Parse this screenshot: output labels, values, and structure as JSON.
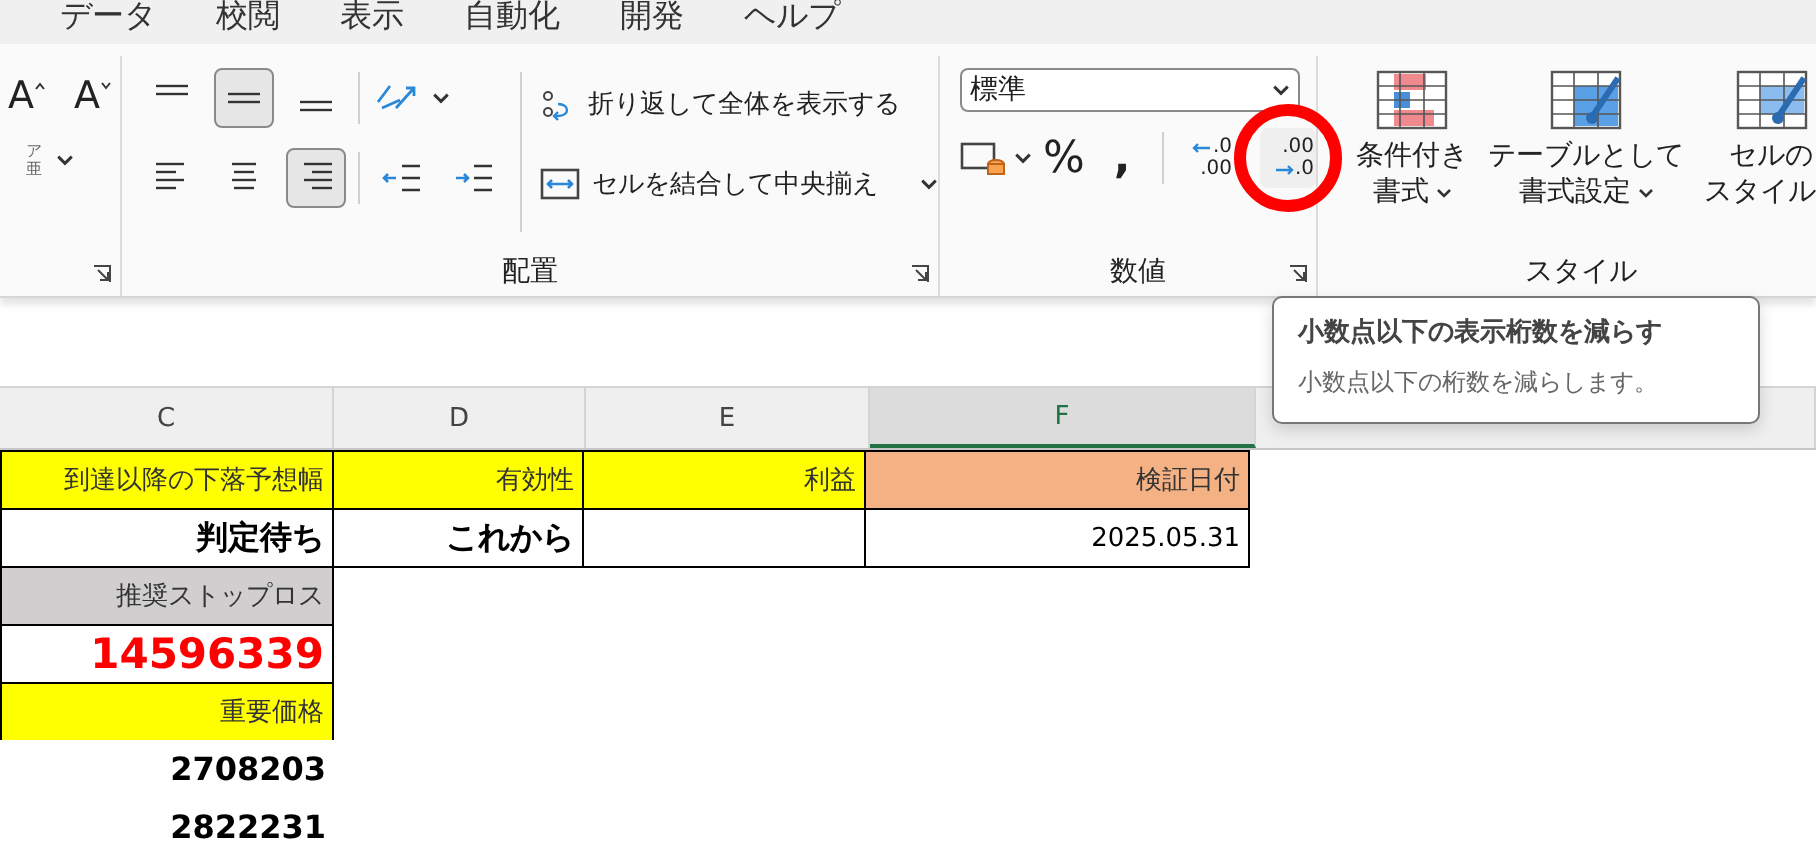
{
  "menu_tabs": [
    "データ",
    "校閲",
    "表示",
    "自動化",
    "開発",
    "ヘルプ"
  ],
  "ribbon": {
    "font_group": {
      "grow_button": "A",
      "shrink_button": "A",
      "phonetic_button": {
        "top": "ア",
        "bottom": "亜"
      }
    },
    "alignment_group": {
      "label": "配置",
      "vertical_buttons": [
        {
          "kind": "top",
          "selected": false
        },
        {
          "kind": "middle",
          "selected": true
        },
        {
          "kind": "bottom",
          "selected": false
        }
      ],
      "horizontal_buttons": [
        {
          "kind": "left",
          "selected": false
        },
        {
          "kind": "center",
          "selected": false
        },
        {
          "kind": "right",
          "selected": true
        }
      ],
      "indent_buttons": [
        {
          "kind": "outdent"
        },
        {
          "kind": "indent"
        }
      ],
      "wrap_text": "折り返して全体を表示する",
      "merge_center": "セルを結合して中央揃え"
    },
    "number_group": {
      "label": "数値",
      "format": "標準",
      "percent": "%",
      "comma": ",",
      "decimal_buttons": [
        {
          "kind": "increase",
          "top": ".0",
          "bottom": ".00",
          "annotated": false
        },
        {
          "kind": "decrease",
          "top": ".00",
          "bottom": ".0",
          "annotated": true
        }
      ]
    },
    "styles_group": {
      "label": "スタイル",
      "buttons": [
        {
          "kind": "conditional",
          "line1": "条件付き",
          "line2": "書式"
        },
        {
          "kind": "table",
          "line1": "テーブルとして",
          "line2": "書式設定"
        },
        {
          "kind": "cell",
          "line1": "セルの",
          "line2": "スタイル"
        }
      ]
    }
  },
  "tooltip": {
    "title": "小数点以下の表示桁数を減らす",
    "body": "小数点以下の桁数を減らします。"
  },
  "sheet": {
    "columns": [
      {
        "label": "C",
        "selected": false
      },
      {
        "label": "D",
        "selected": false
      },
      {
        "label": "E",
        "selected": false
      },
      {
        "label": "F",
        "selected": true
      }
    ],
    "rows": [
      [
        {
          "text": "到達以降の下落予想幅",
          "color": "#ffff00",
          "kind": "label",
          "bordered": true
        },
        {
          "text": "有効性",
          "color": "#ffff00",
          "kind": "label",
          "bordered": true
        },
        {
          "text": "利益",
          "color": "#ffff00",
          "kind": "label",
          "bordered": true
        },
        {
          "text": "検証日付",
          "color": "#f4b183",
          "kind": "label",
          "bordered": true
        }
      ],
      [
        {
          "text": "判定待ち",
          "color": "#ffffff",
          "kind": "bold",
          "bordered": true
        },
        {
          "text": "これから",
          "color": "#ffffff",
          "kind": "bold",
          "bordered": true
        },
        {
          "color": "#ffffff",
          "kind": "plain",
          "bordered": true
        },
        {
          "text": "2025.05.31",
          "color": "#ffffff",
          "kind": "plain",
          "bordered": true
        }
      ],
      [
        {
          "text": "推奨ストップロス",
          "color": "#d0cece",
          "kind": "label",
          "bordered": true
        }
      ],
      [
        {
          "text": "14596339",
          "color": "#ffffff",
          "kind": "alert",
          "bordered": true
        }
      ],
      [
        {
          "text": "重要価格",
          "color": "#ffff00",
          "kind": "label",
          "bordered": true
        }
      ],
      [
        {
          "text": "2708203",
          "color": "#ffffff",
          "kind": "bold",
          "bordered": false
        }
      ],
      [
        {
          "text": "2822231",
          "color": "#ffffff",
          "kind": "bold",
          "bordered": false
        }
      ]
    ]
  }
}
